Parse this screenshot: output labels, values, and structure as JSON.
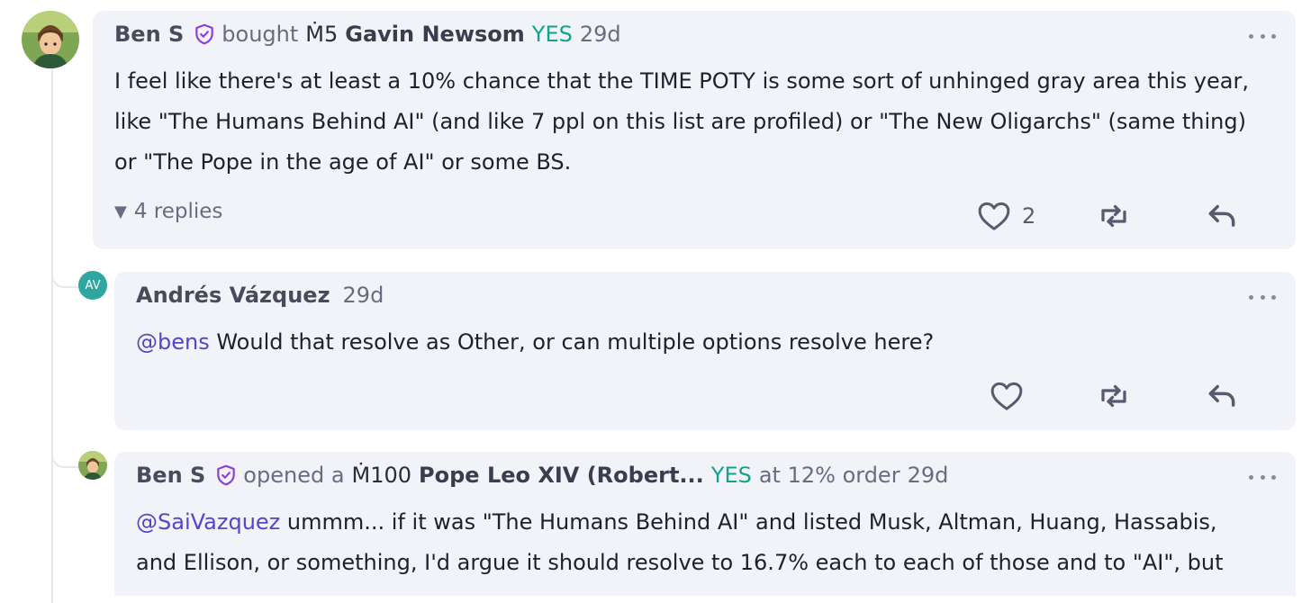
{
  "comments": [
    {
      "user": "Ben S",
      "action": "bought",
      "amount": "Ṁ5",
      "market_option": "Gavin Newsom",
      "outcome": "YES",
      "age": "29d",
      "body_lines": [
        "I feel like there's at least a 10% chance that the TIME POTY is some sort of unhinged gray area this year,",
        "like \"The Humans Behind AI\" (and like 7 ppl on this list are profiled) or \"The New Oligarchs\" (same thing)",
        "or \"The Pope in the age of AI\" or some BS."
      ],
      "replies_label": "4 replies",
      "like_count": "2"
    },
    {
      "user": "Andrés Vázquez",
      "initials": "AV",
      "age": "29d",
      "mention": "@bens",
      "body": " Would that resolve as Other, or can multiple options resolve here?"
    },
    {
      "user": "Ben S",
      "action": "opened a",
      "amount": "Ṁ100",
      "market_option": "Pope Leo XIV (Robert...",
      "outcome": "YES",
      "order_text": "at 12% order",
      "age": "29d",
      "mention": "@SaiVazquez",
      "body_line1": " ummm... if it was \"The Humans Behind AI\" and listed Musk, Altman, Huang, Hassabis,",
      "body_line2": "and Ellison, or something, I'd argue it should resolve to 16.7% each to each of those and to \"AI\", but"
    }
  ],
  "colors": {
    "accent": "#5146c8",
    "yes": "#11a38a",
    "card_bg": "#f2f2f9",
    "badge": "#8b3fd9"
  }
}
